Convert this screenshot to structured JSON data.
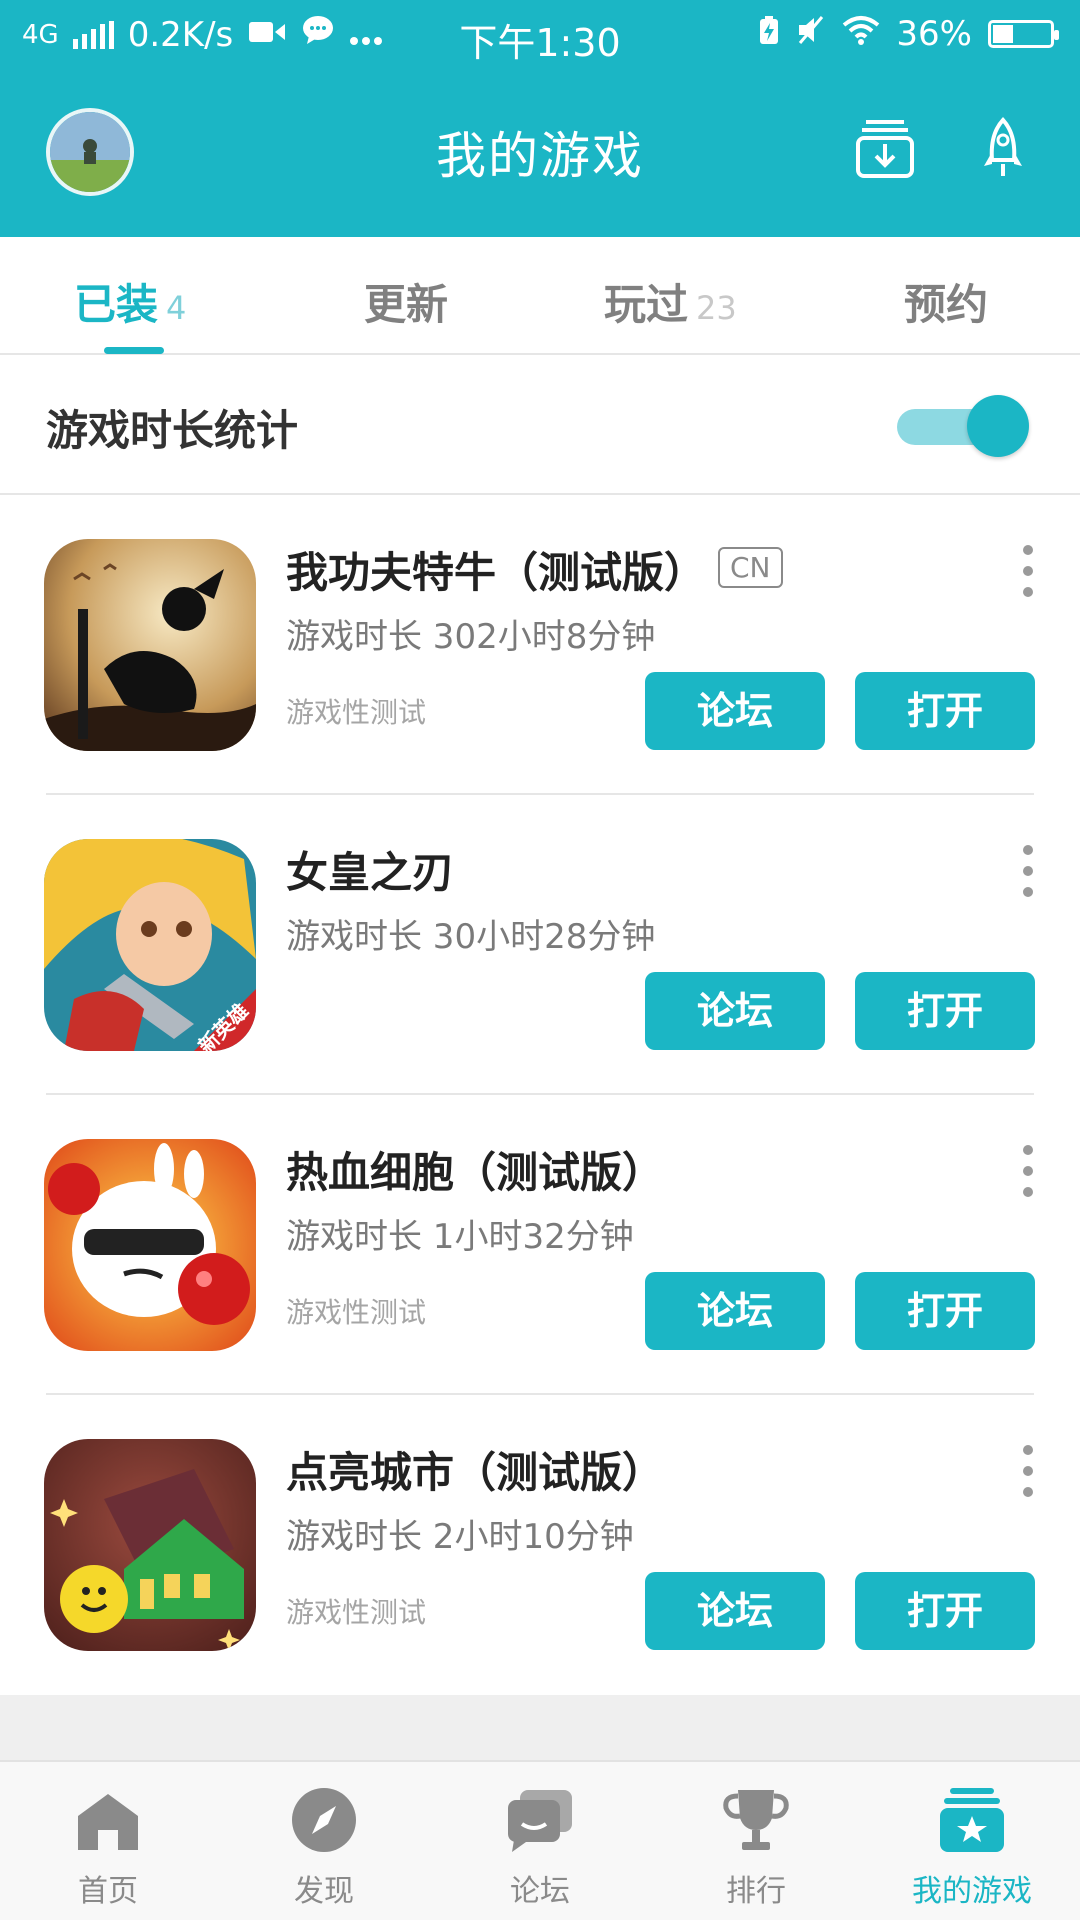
{
  "status_bar": {
    "network": "4G",
    "speed": "0.2K/s",
    "time": "下午1:30",
    "battery": "36%",
    "battery_level": 0.36
  },
  "header": {
    "title": "我的游戏",
    "avatar_icon": "avatar-icon",
    "download_icon": "download-tray-icon",
    "rocket_icon": "rocket-icon"
  },
  "tabs": [
    {
      "label": "已装",
      "count": "4",
      "active": true
    },
    {
      "label": "更新",
      "count": ""
    },
    {
      "label": "玩过",
      "count": "23"
    },
    {
      "label": "预约",
      "count": ""
    }
  ],
  "stats": {
    "label": "游戏时长统计",
    "enabled": true
  },
  "games": [
    {
      "name": "我功夫特牛（测试版）",
      "badge": "CN",
      "time": "游戏时长 302小时8分钟",
      "tag": "游戏性测试",
      "forum_label": "论坛",
      "open_label": "打开"
    },
    {
      "name": "女皇之刃",
      "badge": "",
      "time": "游戏时长 30小时28分钟",
      "tag": "",
      "icon_ribbon": "新英雄",
      "forum_label": "论坛",
      "open_label": "打开"
    },
    {
      "name": "热血细胞（测试版）",
      "badge": "",
      "time": "游戏时长 1小时32分钟",
      "tag": "游戏性测试",
      "forum_label": "论坛",
      "open_label": "打开"
    },
    {
      "name": "点亮城市（测试版）",
      "badge": "",
      "time": "游戏时长 2小时10分钟",
      "tag": "游戏性测试",
      "forum_label": "论坛",
      "open_label": "打开"
    }
  ],
  "bottom_nav": [
    {
      "label": "首页",
      "icon": "home-icon"
    },
    {
      "label": "发现",
      "icon": "compass-icon"
    },
    {
      "label": "论坛",
      "icon": "chat-bubbles-icon"
    },
    {
      "label": "排行",
      "icon": "trophy-icon"
    },
    {
      "label": "我的游戏",
      "icon": "my-games-icon",
      "active": true
    }
  ],
  "colors": {
    "accent": "#1bb6c5",
    "toggle_track": "#8dd9e2",
    "text_primary": "#222222",
    "text_secondary": "#7a7a7a"
  }
}
